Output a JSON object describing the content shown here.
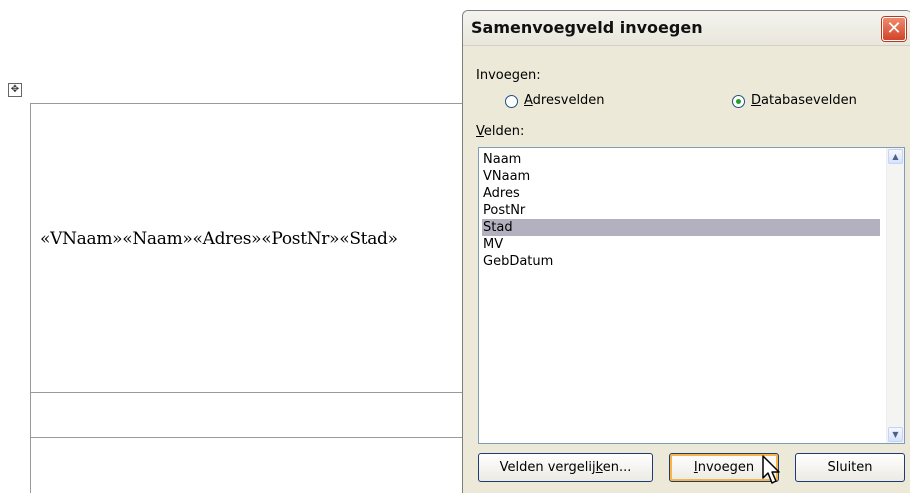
{
  "document": {
    "move_handle_icon": "table-move-icon",
    "merge_fields_text": "«VNaam»«Naam»«Adres»«PostNr»«Stad»"
  },
  "dialog": {
    "title": "Samenvoegveld invoegen",
    "close_glyph": "✕",
    "insert_label": "Invoegen:",
    "radio_address": {
      "prefix": "",
      "accel": "A",
      "rest": "dresvelden",
      "checked": false
    },
    "radio_database": {
      "prefix": "",
      "accel": "D",
      "rest": "atabasevelden",
      "checked": true
    },
    "fields_label": {
      "accel": "V",
      "rest": "elden:"
    },
    "fields": [
      "Naam",
      "VNaam",
      "Adres",
      "PostNr",
      "Stad",
      "MV",
      "GebDatum"
    ],
    "selected_field": "Stad",
    "buttons": {
      "match_fields": {
        "prefix": "Velden vergelij",
        "accel": "k",
        "rest": "en..."
      },
      "insert": {
        "prefix": "",
        "accel": "I",
        "rest": "nvoegen"
      },
      "close": "Sluiten"
    },
    "colors": {
      "dialog_bg": "#ece9d8",
      "selection": "#b3b1c0",
      "close_red": "#d1432a",
      "radio_dot": "#21a121"
    }
  }
}
